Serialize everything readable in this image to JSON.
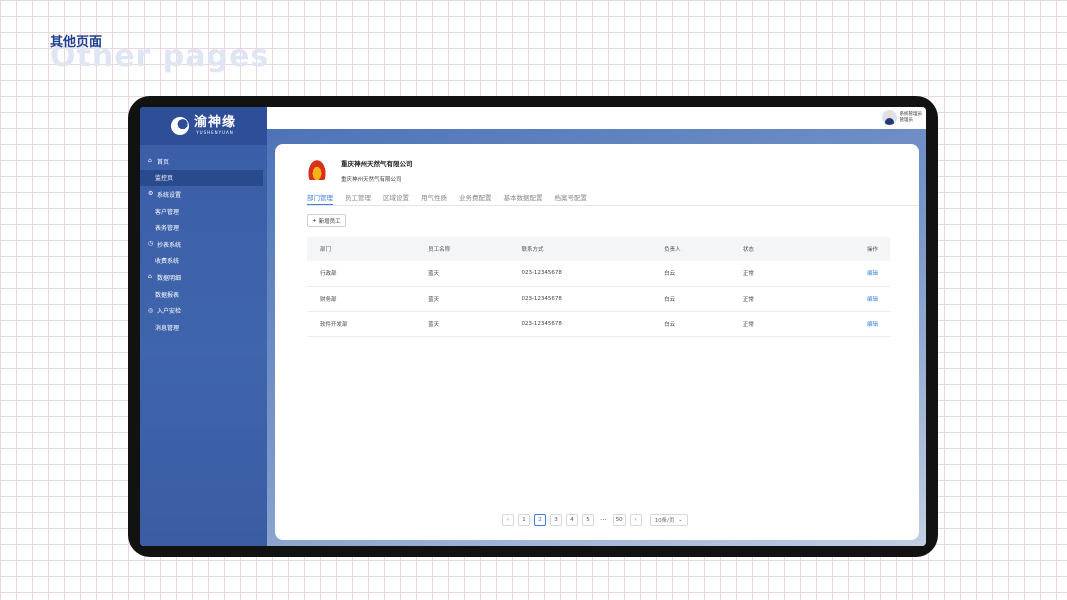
{
  "heading": {
    "title": "其他页面",
    "subtitle": "Other pages"
  },
  "brand": {
    "name_cn": "渝神缘",
    "name_en": "YUSHENYUAN"
  },
  "sidebar": {
    "items": [
      {
        "type": "group",
        "icon": "home-icon",
        "glyph": "⌂",
        "label": "首页"
      },
      {
        "type": "item",
        "label": "监控页",
        "active": true
      },
      {
        "type": "group",
        "icon": "settings-icon",
        "glyph": "⚙",
        "label": "系统设置"
      },
      {
        "type": "item",
        "label": "客户管理"
      },
      {
        "type": "item",
        "label": "表务管理"
      },
      {
        "type": "group",
        "icon": "meter-icon",
        "glyph": "◷",
        "label": "抄表系统"
      },
      {
        "type": "item",
        "label": "收费系统"
      },
      {
        "type": "group",
        "icon": "bank-icon",
        "glyph": "⌂",
        "label": "数据明细"
      },
      {
        "type": "item",
        "label": "数据报表"
      },
      {
        "type": "group",
        "icon": "check-icon",
        "glyph": "◎",
        "label": "入户安检"
      },
      {
        "type": "item",
        "label": "消息管理"
      }
    ]
  },
  "user": {
    "role": "系统管理员",
    "name": "管理员"
  },
  "company": {
    "name": "重庆神州天然气有限公司",
    "subtitle": "重庆神州天然气有限公司"
  },
  "tabs": [
    "部门管理",
    "员工管理",
    "区域设置",
    "用气性质",
    "业务费配置",
    "基本数据配置",
    "档案号配置"
  ],
  "active_tab": 0,
  "add_button": {
    "icon": "+",
    "label": "新增员工"
  },
  "table": {
    "columns": [
      "部门",
      "员工名称",
      "联系方式",
      "负责人",
      "状态",
      "操作"
    ],
    "rows": [
      [
        "行政部",
        "蓝天",
        "023-12345678",
        "白云",
        "正常",
        "编辑"
      ],
      [
        "财务部",
        "蓝天",
        "023-12345678",
        "白云",
        "正常",
        "编辑"
      ],
      [
        "软件开发部",
        "蓝天",
        "023-12345678",
        "白云",
        "正常",
        "编辑"
      ]
    ]
  },
  "pagination": {
    "prev": "‹",
    "next": "›",
    "pages": [
      "1",
      "2",
      "3",
      "4",
      "5"
    ],
    "current": "2",
    "ellipsis": "···",
    "last": "50",
    "page_size": "10条/页",
    "page_size_caret": "⌄"
  },
  "colors": {
    "accent": "#3b7ed8",
    "sidebar": "#3d62aa",
    "frame": "#121212"
  }
}
